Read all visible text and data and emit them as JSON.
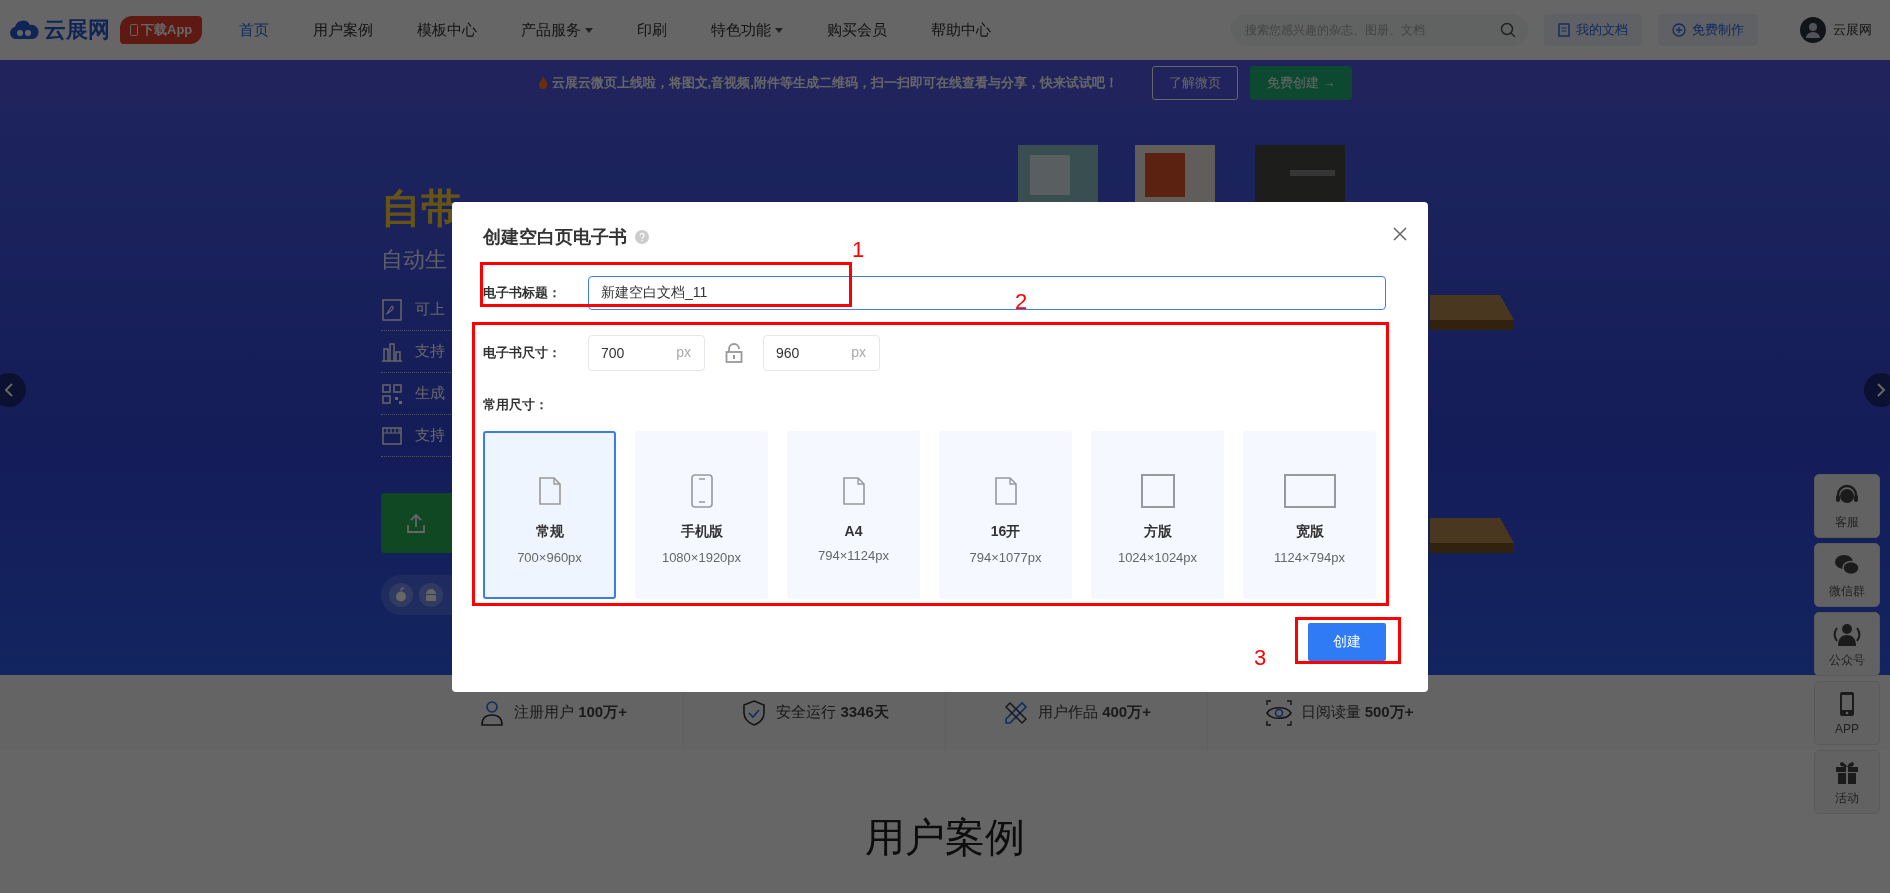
{
  "nav": {
    "logo_text": "云展网",
    "app_badge": "下载App",
    "items": [
      {
        "label": "首页",
        "selected": true,
        "dropdown": false
      },
      {
        "label": "用户案例",
        "selected": false,
        "dropdown": false
      },
      {
        "label": "模板中心",
        "selected": false,
        "dropdown": false
      },
      {
        "label": "产品服务",
        "selected": false,
        "dropdown": true
      },
      {
        "label": "印刷",
        "selected": false,
        "dropdown": false
      },
      {
        "label": "特色功能",
        "selected": false,
        "dropdown": true
      },
      {
        "label": "购买会员",
        "selected": false,
        "dropdown": false
      },
      {
        "label": "帮助中心",
        "selected": false,
        "dropdown": false
      }
    ],
    "search": {
      "placeholder": "搜索您感兴趣的杂志、图册、文档"
    },
    "my_docs": "我的文档",
    "free_make": "免费制作",
    "user": "云展网"
  },
  "announcement": {
    "text": "云展云微页上线啦，将图文,音视频,附件等生成二维码，扫一扫即可在线查看与分享，快来试试吧！",
    "buttons": [
      {
        "label": "了解微页",
        "kind": "outline"
      },
      {
        "label": "免费创建 →",
        "kind": "filled"
      }
    ]
  },
  "hero": {
    "title": "自带",
    "subtitle": "自动生",
    "features": [
      "可上",
      "支持",
      "生成",
      "支持"
    ]
  },
  "sidebar": [
    "客服",
    "微信群",
    "公众号",
    "APP",
    "活动"
  ],
  "stats": [
    "注册用户 **100万+**",
    "安全运行 **3346天**",
    "用户作品 **400万+**",
    "日阅读量 **500万+**"
  ],
  "cases_title": "用户案例",
  "dialog": {
    "title": "创建空白页电子书",
    "title_field": {
      "label": "电子书标题：",
      "value": "新建空白文档_11",
      "focused": true
    },
    "size": {
      "label": "电子书尺寸：",
      "width": {
        "value": "700",
        "unit": "px"
      },
      "height": {
        "value": "960",
        "unit": "px"
      },
      "locked": false
    },
    "presets_label": "常用尺寸：",
    "presets": [
      {
        "name": "常规",
        "size": "700×960px",
        "kind": "page",
        "selected": true
      },
      {
        "name": "手机版",
        "size": "1080×1920px",
        "kind": "phone",
        "selected": false
      },
      {
        "name": "A4",
        "size": "794×1124px",
        "kind": "page",
        "selected": false
      },
      {
        "name": "16开",
        "size": "794×1077px",
        "kind": "page",
        "selected": false
      },
      {
        "name": "方版",
        "size": "1024×1024px",
        "kind": "square",
        "selected": false
      },
      {
        "name": "宽版",
        "size": "1124×794px",
        "kind": "wide",
        "selected": false
      }
    ],
    "create_button": "创建"
  },
  "annotations": [
    {
      "label": "1"
    },
    {
      "label": "2"
    },
    {
      "label": "3"
    }
  ]
}
